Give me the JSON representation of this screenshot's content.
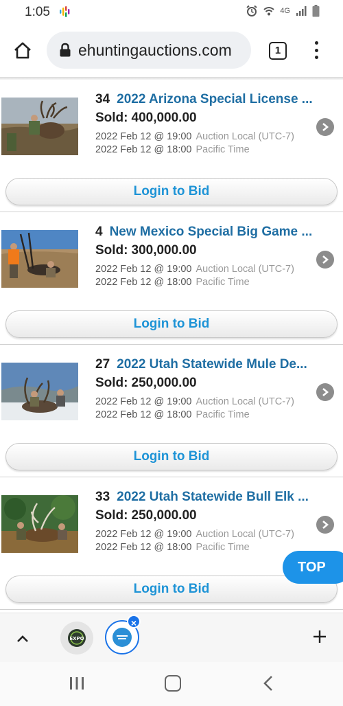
{
  "status_bar": {
    "time": "1:05",
    "network": "4G"
  },
  "browser": {
    "url": "ehuntingauctions.com",
    "tab_count": "1"
  },
  "listings": [
    {
      "lot": "34",
      "title": "2022 Arizona Special License ...",
      "sold_label": "Sold:",
      "sold_amount": "400,000.00",
      "time1": "2022 Feb 12 @ 19:00",
      "tz1": "Auction Local (UTC-7)",
      "time2": "2022 Feb 12 @ 18:00",
      "tz2": "Pacific Time",
      "button": "Login to Bid"
    },
    {
      "lot": "4",
      "title": "New Mexico Special Big Game ...",
      "sold_label": "Sold:",
      "sold_amount": "300,000.00",
      "time1": "2022 Feb 12 @ 19:00",
      "tz1": "Auction Local (UTC-7)",
      "time2": "2022 Feb 12 @ 18:00",
      "tz2": "Pacific Time",
      "button": "Login to Bid"
    },
    {
      "lot": "27",
      "title": "2022 Utah Statewide Mule De...",
      "sold_label": "Sold:",
      "sold_amount": "250,000.00",
      "time1": "2022 Feb 12 @ 19:00",
      "tz1": "Auction Local (UTC-7)",
      "time2": "2022 Feb 12 @ 18:00",
      "tz2": "Pacific Time",
      "button": "Login to Bid"
    },
    {
      "lot": "33",
      "title": "2022 Utah Statewide Bull Elk ...",
      "sold_label": "Sold:",
      "sold_amount": "250,000.00",
      "time1": "2022 Feb 12 @ 19:00",
      "tz1": "Auction Local (UTC-7)",
      "time2": "2022 Feb 12 @ 18:00",
      "tz2": "Pacific Time",
      "button": "Login to Bid"
    }
  ],
  "top_button": "TOP",
  "tab_strip": {
    "tab1_icon": "expo-logo-icon",
    "tab2_icon": "site-logo-icon",
    "tab1_logo_text": "EXPO"
  },
  "colors": {
    "title_blue": "#1f6ea3",
    "button_text_blue": "#1d93d6",
    "top_button_bg": "#1d93e8",
    "chrome_accent": "#1a73e8"
  }
}
